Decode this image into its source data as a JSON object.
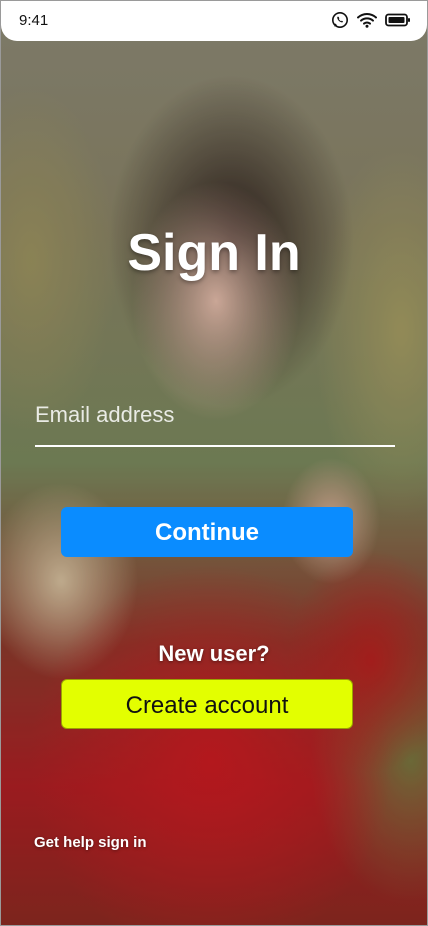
{
  "status_bar": {
    "time": "9:41",
    "icons": [
      "whatsapp-icon",
      "wifi-icon",
      "battery-icon"
    ]
  },
  "screen": {
    "title": "Sign In",
    "email_placeholder": "Email address",
    "email_value": "",
    "continue_label": "Continue",
    "new_user_text": "New user?",
    "create_account_label": "Create account",
    "help_link": "Get help sign in"
  },
  "colors": {
    "primary_button": "#0a8cff",
    "secondary_button": "#e3ff00",
    "text_on_image": "#ffffff"
  }
}
